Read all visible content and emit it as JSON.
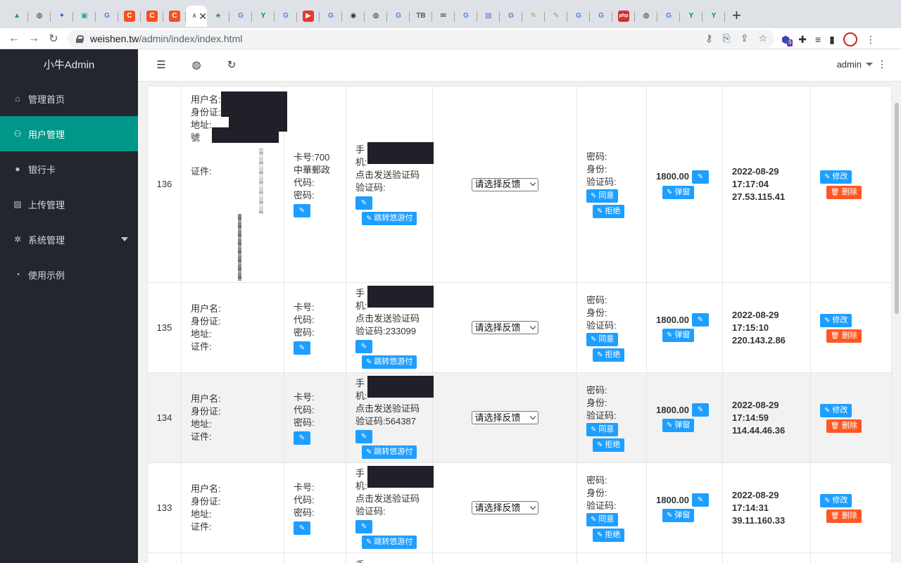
{
  "browser": {
    "url_host": "weishen.tw",
    "url_path": "/admin/index/index.html",
    "tabs": [
      {
        "icon": "drive-icon",
        "color": "#0f9d58",
        "glyph": "▲"
      },
      {
        "icon": "globe-icon",
        "color": "#333333",
        "glyph": "◍"
      },
      {
        "icon": "bird-icon",
        "color": "#1565c0",
        "glyph": "✦"
      },
      {
        "icon": "image-icon",
        "color": "#26a69a",
        "glyph": "▣"
      },
      {
        "icon": "google-icon",
        "color": "#4285f4",
        "glyph": "G"
      },
      {
        "icon": "c-icon",
        "color": "#f4511e",
        "glyph": "C"
      },
      {
        "icon": "c-icon",
        "color": "#f4511e",
        "glyph": "C"
      },
      {
        "icon": "c-icon",
        "color": "#f4511e",
        "glyph": "C"
      },
      {
        "icon": "active-tab",
        "color": "#888888",
        "glyph": "∧"
      },
      {
        "icon": "leaf-icon",
        "color": "#43a047",
        "glyph": "♣"
      },
      {
        "icon": "google-icon",
        "color": "#4285f4",
        "glyph": "G"
      },
      {
        "icon": "y-icon",
        "color": "#00897b",
        "glyph": "Y"
      },
      {
        "icon": "google-icon",
        "color": "#4285f4",
        "glyph": "G"
      },
      {
        "icon": "youtube-icon",
        "color": "#e53935",
        "glyph": "▶"
      },
      {
        "icon": "google-icon",
        "color": "#4285f4",
        "glyph": "G"
      },
      {
        "icon": "circle-icon",
        "color": "#333333",
        "glyph": "◉"
      },
      {
        "icon": "globe-icon",
        "color": "#333333",
        "glyph": "◍"
      },
      {
        "icon": "google-icon",
        "color": "#4285f4",
        "glyph": "G"
      },
      {
        "icon": "tb-icon",
        "color": "#555555",
        "glyph": "TB"
      },
      {
        "icon": "mail-icon",
        "color": "#333333",
        "glyph": "✉"
      },
      {
        "icon": "google-icon",
        "color": "#4285f4",
        "glyph": "G"
      },
      {
        "icon": "doc-icon",
        "color": "#5c6bc0",
        "glyph": "▤"
      },
      {
        "icon": "google-icon",
        "color": "#4285f4",
        "glyph": "G"
      },
      {
        "icon": "pen-icon",
        "color": "#7cb342",
        "glyph": "✎"
      },
      {
        "icon": "pen-icon",
        "color": "#7cb342",
        "glyph": "✎"
      },
      {
        "icon": "google-icon",
        "color": "#4285f4",
        "glyph": "G"
      },
      {
        "icon": "google-icon",
        "color": "#4285f4",
        "glyph": "G"
      },
      {
        "icon": "php-icon",
        "color": "#d32f2f",
        "glyph": "php"
      },
      {
        "icon": "globe-icon",
        "color": "#333333",
        "glyph": "◍"
      },
      {
        "icon": "google-icon",
        "color": "#4285f4",
        "glyph": "G"
      },
      {
        "icon": "y-icon",
        "color": "#00897b",
        "glyph": "Y"
      },
      {
        "icon": "y-icon",
        "color": "#00897b",
        "glyph": "Y"
      }
    ],
    "extension_badge": "9"
  },
  "sidebar": {
    "logo": "小牛Admin",
    "items": [
      {
        "label": "管理首页",
        "icon": "home-icon",
        "glyph": "⌂"
      },
      {
        "label": "用户管理",
        "icon": "user-icon",
        "glyph": "⚇"
      },
      {
        "label": "银行卡",
        "icon": "card-icon",
        "glyph": "●"
      },
      {
        "label": "上传管理",
        "icon": "picture-icon",
        "glyph": "▨"
      },
      {
        "label": "系统管理",
        "icon": "gear-icon",
        "glyph": "✲"
      },
      {
        "label": "使用示例",
        "icon": "palette-icon",
        "glyph": "◔"
      }
    ],
    "active_index": 1,
    "accent": "#009688"
  },
  "header": {
    "user": "admin"
  },
  "labels": {
    "username": "用户名:",
    "id_card": "身份证:",
    "address": "地址:",
    "address_suffix": "號",
    "certificate": "证件:",
    "card_no": "卡号:",
    "code": "代码:",
    "password": "密码:",
    "phone_a": "手",
    "phone_b": "机:",
    "send_code": "点击发送验证码",
    "verify_code": "验证码:",
    "jump_button": "跳转悠游付",
    "feedback_select": "请选择反馈",
    "pwd": "密码:",
    "identity": "身份:",
    "verify": "验证码:",
    "agree_button": "同意",
    "reject_button": "拒绝",
    "popup_button": "弹窗",
    "edit_button": "修改",
    "delete_button": "删除",
    "next_row_phone": "手"
  },
  "rows": [
    {
      "id": "136",
      "card_no": "700",
      "bank": "中華郵政",
      "verify_code": "",
      "amount": "1800.00",
      "date": "2022-08-29",
      "time": "17:17:04",
      "ip": "27.53.115.41"
    },
    {
      "id": "135",
      "card_no": "",
      "bank": "",
      "verify_code": "233099",
      "amount": "1800.00",
      "date": "2022-08-29",
      "time": "17:15:10",
      "ip": "220.143.2.86"
    },
    {
      "id": "134",
      "card_no": "",
      "bank": "",
      "verify_code": "564387",
      "amount": "1800.00",
      "date": "2022-08-29",
      "time": "17:14:59",
      "ip": "114.44.46.36"
    },
    {
      "id": "133",
      "card_no": "",
      "bank": "",
      "verify_code": "",
      "amount": "1800.00",
      "date": "2022-08-29",
      "time": "17:14:31",
      "ip": "39.11.160.33"
    }
  ]
}
